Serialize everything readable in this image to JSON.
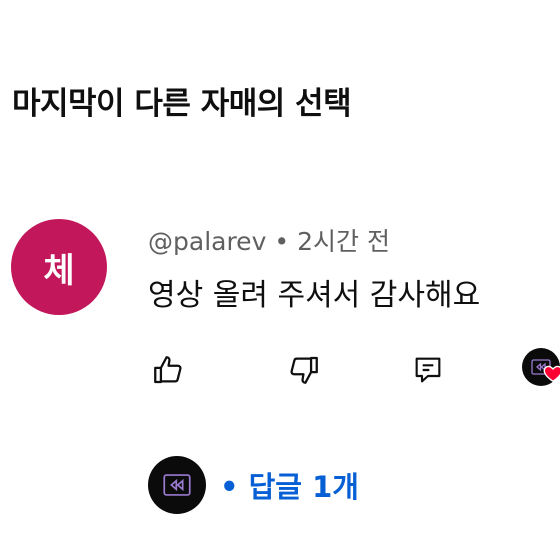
{
  "video": {
    "title": "마지막이 다른 자매의 선택"
  },
  "comment": {
    "avatar_initial": "체",
    "avatar_color": "#c2185b",
    "author": "@palarev",
    "separator": "•",
    "timestamp": "2시간 전",
    "text": "영상 올려 주셔서 감사해요"
  },
  "actions": {
    "like_icon": "thumbs-up-icon",
    "dislike_icon": "thumbs-down-icon",
    "reply_icon": "comment-reply-icon",
    "creator_heart_icon": "creator-heart-icon"
  },
  "replies": {
    "label": "• 답글 1개",
    "accent_color": "#065fd4"
  }
}
